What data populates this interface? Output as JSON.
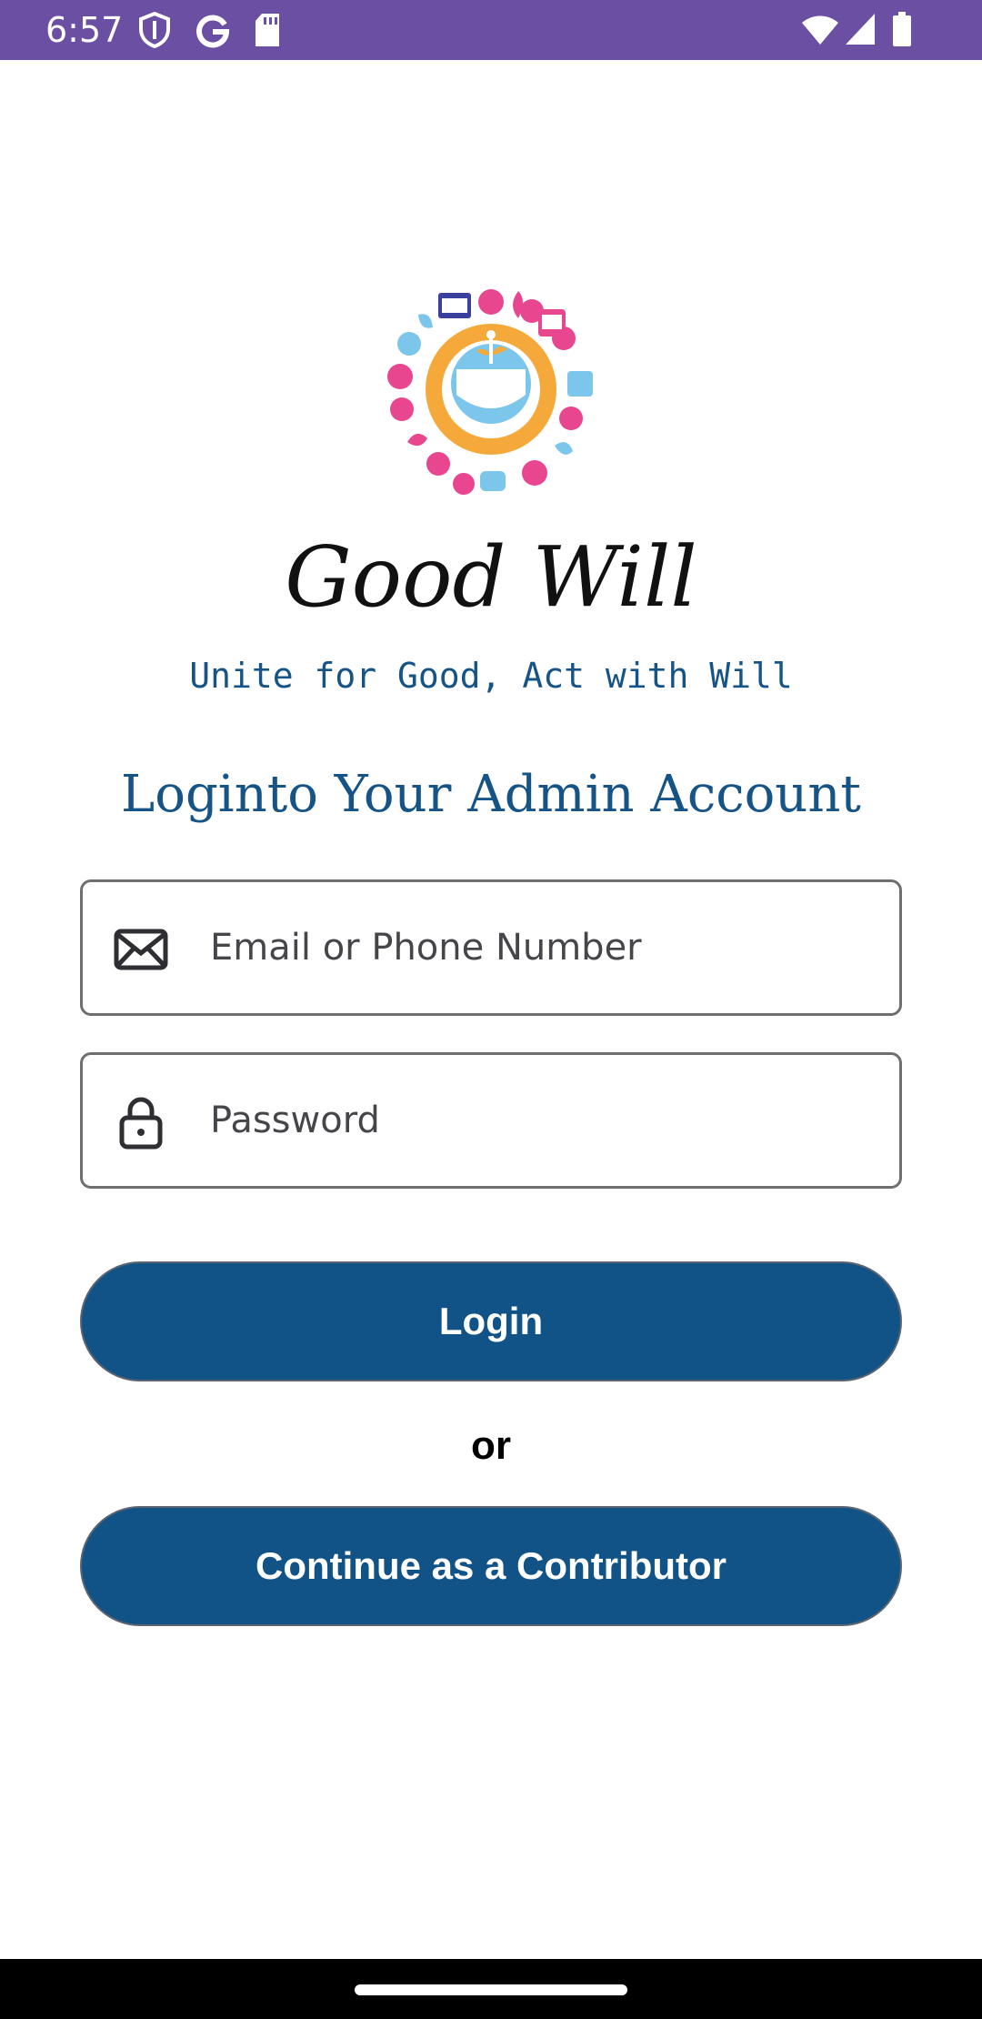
{
  "status_bar": {
    "time": "6:57",
    "left_icons": [
      "shield-icon",
      "google-g-icon",
      "sd-card-icon"
    ],
    "right_icons": [
      "wifi-icon",
      "signal-icon",
      "battery-icon"
    ],
    "background": "#6a4fa3"
  },
  "brand": {
    "logo_icon": "goodwill-logo-icon",
    "title": "Good Will",
    "tagline": "Unite for Good, Act with Will"
  },
  "login": {
    "heading": "Loginto Your Admin Account",
    "email_field": {
      "placeholder": "Email or Phone Number",
      "value": "",
      "icon": "envelope-icon"
    },
    "password_field": {
      "placeholder": "Password",
      "value": "",
      "icon": "lock-icon"
    },
    "login_button": "Login",
    "or_text": "or",
    "contributor_button": "Continue as a Contributor"
  },
  "colors": {
    "accent": "#125387",
    "heading_text": "#165487",
    "logo_orange": "#f6a93b",
    "logo_pink": "#e8468f",
    "logo_blue": "#7cc6ec"
  }
}
